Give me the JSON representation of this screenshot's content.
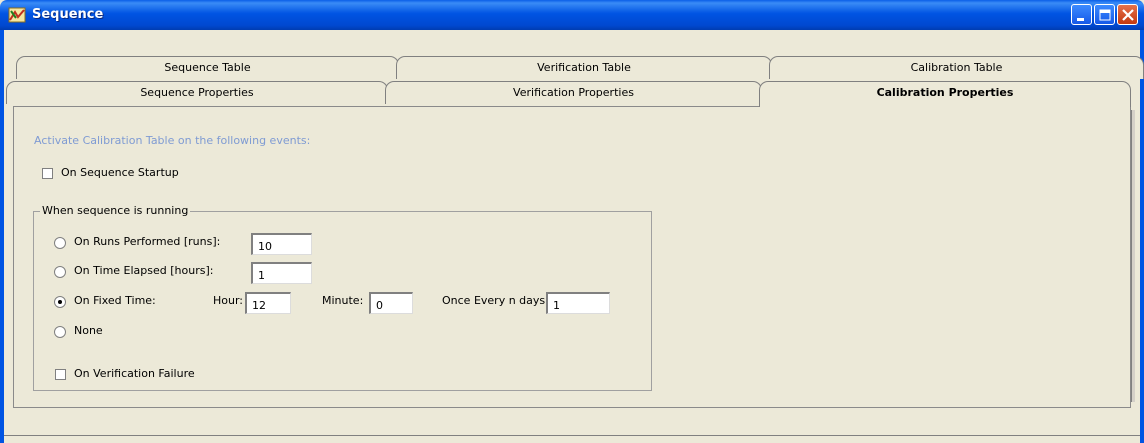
{
  "window": {
    "title": "Sequence",
    "icon": "sequence-app-icon"
  },
  "tabs_row1": [
    {
      "label": "Sequence Table"
    },
    {
      "label": "Verification Table"
    },
    {
      "label": "Calibration Table"
    }
  ],
  "tabs_row2": [
    {
      "label": "Sequence Properties"
    },
    {
      "label": "Verification Properties"
    },
    {
      "label": "Calibration Properties",
      "selected": true
    }
  ],
  "panel": {
    "hint": "Activate Calibration Table on the following events:",
    "startup": {
      "label": "On Sequence Startup",
      "checked": false
    },
    "group": {
      "title": "When sequence is running",
      "runs": {
        "label": "On Runs Performed [runs]:",
        "value": "10",
        "selected": false
      },
      "time": {
        "label": "On Time Elapsed [hours]:",
        "value": "1",
        "selected": false
      },
      "fixed": {
        "label": "On Fixed Time:",
        "selected": true,
        "hour_label": "Hour:",
        "hour_value": "12",
        "minute_label": "Minute:",
        "minute_value": "0",
        "days_label": "Once Every n days:",
        "days_value": "1"
      },
      "none": {
        "label": "None",
        "selected": false
      },
      "verification_failure": {
        "label": "On Verification Failure",
        "checked": false
      }
    }
  },
  "colors": {
    "titlebar": "#0054e3",
    "hint_text": "#7f9bd3",
    "background": "#ECE9D8"
  }
}
